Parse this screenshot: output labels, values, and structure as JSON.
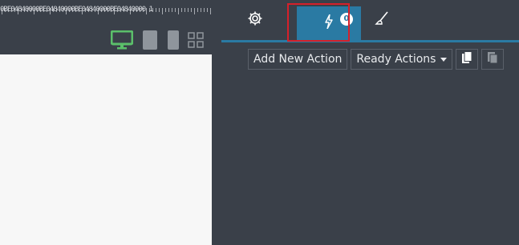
{
  "ruler": {
    "label": "0BE04840000BE04840000BE04840000BE04840000 1"
  },
  "devices": [
    {
      "name": "desktop",
      "icon": "desktop-icon",
      "color": "#5bbf6a",
      "active": true
    },
    {
      "name": "tablet",
      "icon": "tablet-icon",
      "color": "#8f959c",
      "active": false
    },
    {
      "name": "phone",
      "icon": "phone-icon",
      "color": "#8f959c",
      "active": false
    },
    {
      "name": "grid",
      "icon": "grid-icon",
      "color": "#8f959c",
      "active": false
    }
  ],
  "tabs": [
    {
      "id": "settings",
      "icon": "gear-icon"
    },
    {
      "id": "actions",
      "icon": "lightning-icon",
      "badge": "0",
      "active": true
    },
    {
      "id": "style",
      "icon": "brush-icon"
    }
  ],
  "toolbar": {
    "add_action_label": "Add New Action",
    "ready_actions_label": "Ready Actions",
    "copy_icon": "copy-icon",
    "paste_icon": "paste-icon"
  },
  "colors": {
    "panel_bg": "#3a4049",
    "accent": "#2a7aa3",
    "canvas_bg": "#f7f7f7",
    "highlight": "#d6202a"
  }
}
